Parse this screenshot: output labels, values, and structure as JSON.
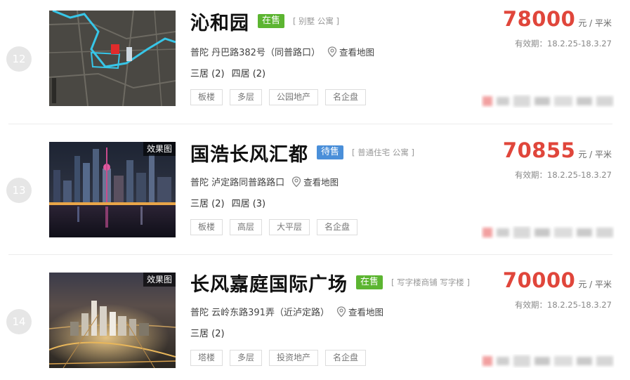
{
  "listings": [
    {
      "rank": "12",
      "name": "沁和园",
      "status": "在售",
      "status_color": "#5cb531",
      "types": "[ 别墅 公寓 ]",
      "address": "普陀 丹巴路382号（同普路口）",
      "map_link": "查看地图",
      "rooms": [
        "三居 (2)",
        "四居 (2)"
      ],
      "tags": [
        "板楼",
        "多层",
        "公园地产",
        "名企盘"
      ],
      "price": "78000",
      "unit": "元 / 平米",
      "valid": "有效期：18.2.25-18.3.27",
      "effect_label": ""
    },
    {
      "rank": "13",
      "name": "国浩长风汇都",
      "status": "待售",
      "status_color": "#4a8fd9",
      "types": "[ 普通住宅 公寓 ]",
      "address": "普陀 泸定路同普路路口",
      "map_link": "查看地图",
      "rooms": [
        "三居 (2)",
        "四居 (3)"
      ],
      "tags": [
        "板楼",
        "高层",
        "大平层",
        "名企盘"
      ],
      "price": "70855",
      "unit": "元 / 平米",
      "valid": "有效期：18.2.25-18.3.27",
      "effect_label": "效果图"
    },
    {
      "rank": "14",
      "name": "长风嘉庭国际广场",
      "status": "在售",
      "status_color": "#5cb531",
      "types": "[ 写字楼商铺 写字楼 ]",
      "address": "普陀 云岭东路391弄（近泸定路）",
      "map_link": "查看地图",
      "rooms": [
        "三居 (2)"
      ],
      "tags": [
        "塔楼",
        "多层",
        "投资地产",
        "名企盘"
      ],
      "price": "70000",
      "unit": "元 / 平米",
      "valid": "有效期：18.2.25-18.3.27",
      "effect_label": "效果图"
    }
  ],
  "colors": {
    "price": "#e0463b",
    "rank_badge": "#e6e6e6"
  }
}
